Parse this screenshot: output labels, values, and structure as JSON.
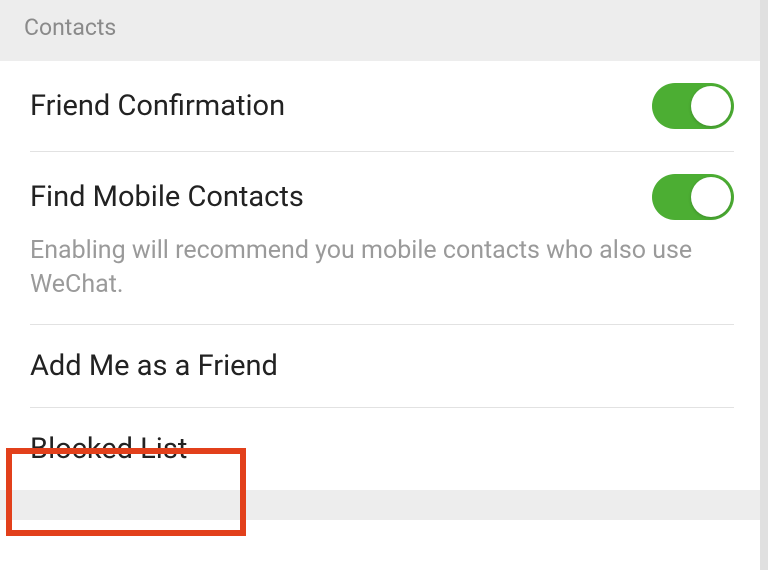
{
  "section": {
    "title": "Contacts"
  },
  "rows": {
    "friendConfirmation": {
      "label": "Friend Confirmation",
      "toggle": true
    },
    "findMobileContacts": {
      "label": "Find Mobile Contacts",
      "toggle": true,
      "description": "Enabling will recommend you mobile contacts who also use WeChat."
    },
    "addMeAsFriend": {
      "label": "Add Me as a Friend"
    },
    "blockedList": {
      "label": "Blocked List"
    }
  },
  "highlight": {
    "target": "blocked-list-row"
  }
}
